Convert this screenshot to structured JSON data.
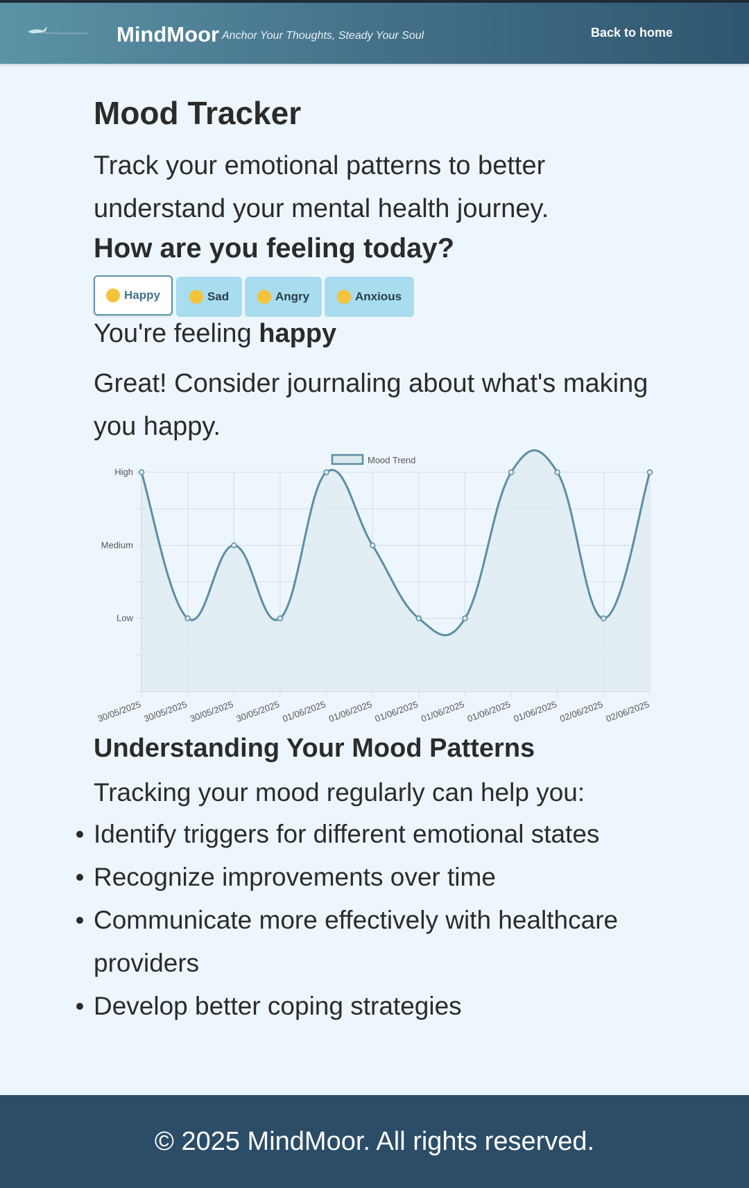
{
  "header": {
    "brand": "MindMoor",
    "tagline": "Anchor Your Thoughts, Steady Your Soul",
    "back_link": "Back to home"
  },
  "main": {
    "title": "Mood Tracker",
    "intro": "Track your emotional patterns to better understand your mental health journey.",
    "question": "How are you feeling today?",
    "moods": [
      {
        "label": "Happy",
        "icon": "smiling-face-icon",
        "selected": true
      },
      {
        "label": "Sad",
        "icon": "crying-face-icon",
        "selected": false
      },
      {
        "label": "Angry",
        "icon": "angry-face-icon",
        "selected": false
      },
      {
        "label": "Anxious",
        "icon": "anxious-face-icon",
        "selected": false
      }
    ],
    "feeling_prefix": "You're feeling ",
    "feeling_value": "happy",
    "advice": "Great! Consider journaling about what's making you happy.",
    "patterns_title": "Understanding Your Mood Patterns",
    "help_intro": "Tracking your mood regularly can help you:",
    "benefits": [
      "Identify triggers for different emotional states",
      "Recognize improvements over time",
      "Communicate more effectively with healthcare providers",
      "Develop better coping strategies"
    ]
  },
  "footer": {
    "copyright": "© 2025 MindMoor. All rights reserved."
  },
  "colors": {
    "header_start": "#5b93a6",
    "header_end": "#2f5670",
    "background": "#eef6fd",
    "mood_button": "#a8dcef",
    "line": "#5b8ea3",
    "fill": "#dde9f0",
    "footer": "#2c4d67"
  },
  "chart_data": {
    "type": "line",
    "legend": "Mood Trend",
    "legend_position": "top-center",
    "x": [
      "30/05/2025",
      "30/05/2025",
      "30/05/2025",
      "30/05/2025",
      "01/06/2025",
      "01/06/2025",
      "01/06/2025",
      "01/06/2025",
      "01/06/2025",
      "01/06/2025",
      "02/06/2025",
      "02/06/2025"
    ],
    "y_levels": [
      "Low",
      "Medium",
      "High"
    ],
    "values": [
      3,
      1,
      2,
      1,
      3,
      2,
      1,
      1,
      3,
      3,
      1,
      3
    ],
    "ylim": [
      0,
      3
    ],
    "grid": true,
    "filled": true,
    "smooth": true
  }
}
